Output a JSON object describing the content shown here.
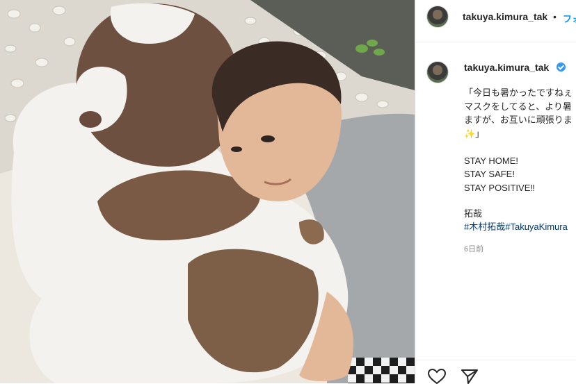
{
  "post": {
    "username": "takuya.kimura_tak",
    "separator": "•",
    "follow_label": "フォ",
    "caption_lines": [
      "「今日も暑かったですねぇ",
      "マスクをしてると、より暑",
      "ますが、お互いに頑張りま",
      "✨」",
      "",
      "STAY HOME!",
      "STAY SAFE!",
      "STAY POSITIVE‼︎",
      "",
      "拓哉"
    ],
    "hashtags": "#木村拓哉#TakuyaKimura",
    "timestamp": "6日前"
  },
  "icons": {
    "like": "heart-icon",
    "share": "paper-plane-icon",
    "verified": "verified-badge-icon"
  },
  "colors": {
    "accent": "#0095f6",
    "verified": "#3897f0",
    "hashtag": "#00376b"
  }
}
